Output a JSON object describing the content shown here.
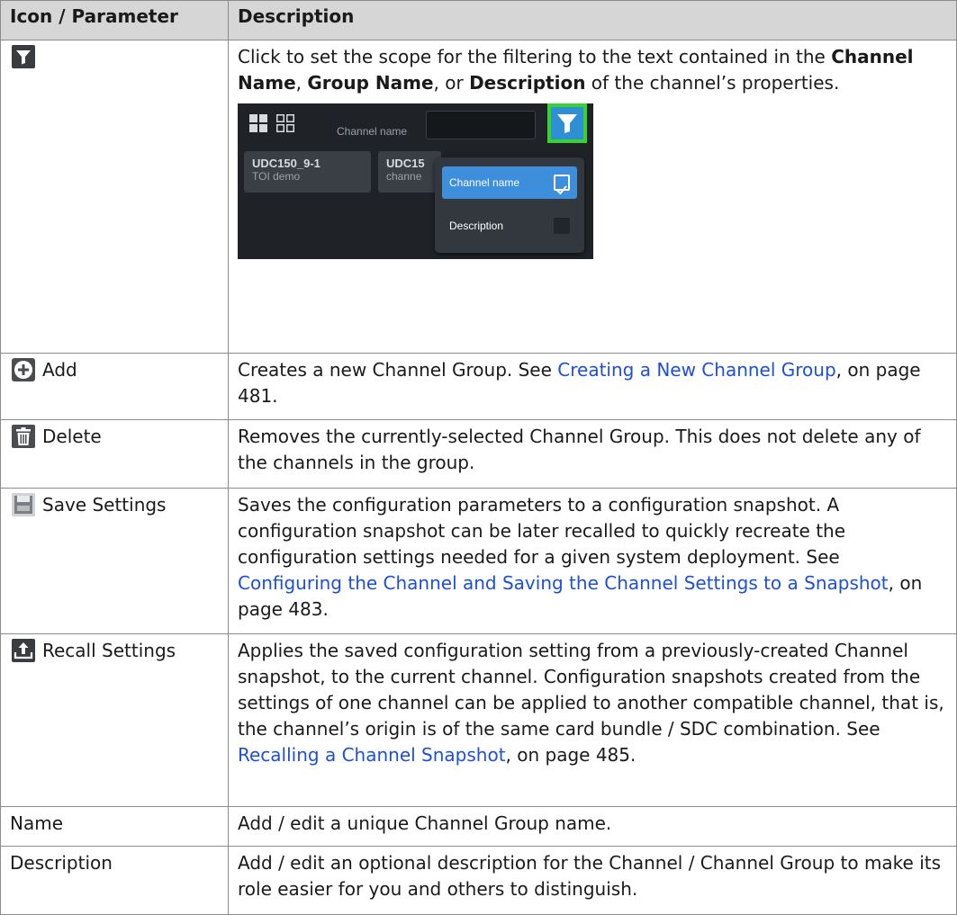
{
  "table": {
    "headers": [
      "Icon / Parameter",
      "Description"
    ],
    "rows": {
      "filter": {
        "icon": "filter-icon",
        "desc_prefix": "Click to set the scope for the filtering to the text contained in the ",
        "desc_channel_name": "Channel Name",
        "desc_sep1": ", ",
        "desc_group_name": "Group Name",
        "desc_sep2": ", or ",
        "desc_description": "Description",
        "desc_suffix": " of the channel’s properties."
      },
      "add": {
        "icon": "add-circle-icon",
        "label": "Add",
        "desc_prefix": "Creates a new Channel Group. See ",
        "link": "Creating a New Channel Group",
        "desc_suffix": ", on page 481."
      },
      "delete": {
        "icon": "trash-icon",
        "label": "Delete",
        "desc": "Removes the currently-selected Channel Group. This does not delete any of the channels in the group."
      },
      "save": {
        "icon": "save-floppy-icon",
        "label": "Save Settings",
        "desc_prefix": "Saves the configuration parameters to a configuration snapshot. A configuration snapshot can be later recalled to quickly recreate the configuration settings needed for a given system deployment. See ",
        "link": "Configuring the Channel and Saving the Channel Settings to a Snapshot",
        "desc_suffix": ", on page 483."
      },
      "recall": {
        "icon": "upload-icon",
        "label": "Recall Settings",
        "desc_prefix": "Applies the saved configuration setting from a previously-created Channel snapshot, to the current channel. Configuration snapshots created from the settings of one channel can be applied to another compatible channel, that is, the channel’s origin is of the same card bundle / SDC combination. See ",
        "link": "Recalling a Channel Snapshot",
        "desc_suffix": ", on page 485."
      },
      "name": {
        "label": "Name",
        "desc": "Add / edit a unique Channel Group name."
      },
      "description": {
        "label": "Description",
        "desc": "Add / edit an optional description for the Channel / Channel Group to make its role easier for you and others to distinguish."
      }
    }
  },
  "screenshot": {
    "filter_label": "Channel name",
    "tiles": [
      {
        "title": "UDC150_9-1",
        "subtitle": "TOI demo"
      },
      {
        "title": "UDC15",
        "subtitle": "channe"
      }
    ],
    "dropdown": [
      {
        "label": "Channel name",
        "checked": true
      },
      {
        "label": "Description",
        "checked": false
      }
    ],
    "colors": {
      "highlight": "#38d32e",
      "filter_button": "#2f8fd4",
      "selected_item": "#3d8edb",
      "link": "#1e4fd8"
    }
  }
}
